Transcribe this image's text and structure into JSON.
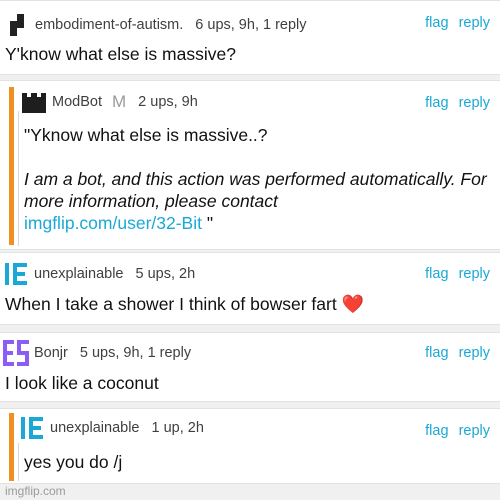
{
  "comments": [
    {
      "username": "embodiment-of-autism.",
      "meta": "6 ups, 9h, 1 reply",
      "text": "Y'know what else is massive?",
      "icon": "pixel-avatar-icon"
    },
    {
      "username": "ModBot",
      "mod_badge": "M",
      "meta": "2 ups, 9h",
      "text_quote": "\"Yknow what else is massive..?",
      "text_bot": "I am a bot, and this action was performed automatically. For more information, please contact",
      "text_link": "imgflip.com/user/32-Bit",
      "text_end": " \"",
      "icon": "castle-icon"
    },
    {
      "username": "unexplainable",
      "meta": "5 ups, 2h",
      "text": "When I take a shower I think of bowser fart",
      "emoji": "❤️",
      "icon": "letter-e-blue-icon"
    },
    {
      "username": "Bonjr",
      "meta": "5 ups, 9h, 1 reply",
      "text": "I look like a coconut",
      "icon": "letters-es-purple-icon"
    },
    {
      "username": "unexplainable",
      "meta": "1 up, 2h",
      "text": "yes you do /j",
      "icon": "letter-e-blue-icon"
    }
  ],
  "actions": {
    "flag": "flag",
    "reply": "reply"
  },
  "footer": "imgflip.com",
  "colors": {
    "accent": "#1aa9d6",
    "reply_bar": "#f0901e",
    "heart": "#e0282e"
  }
}
